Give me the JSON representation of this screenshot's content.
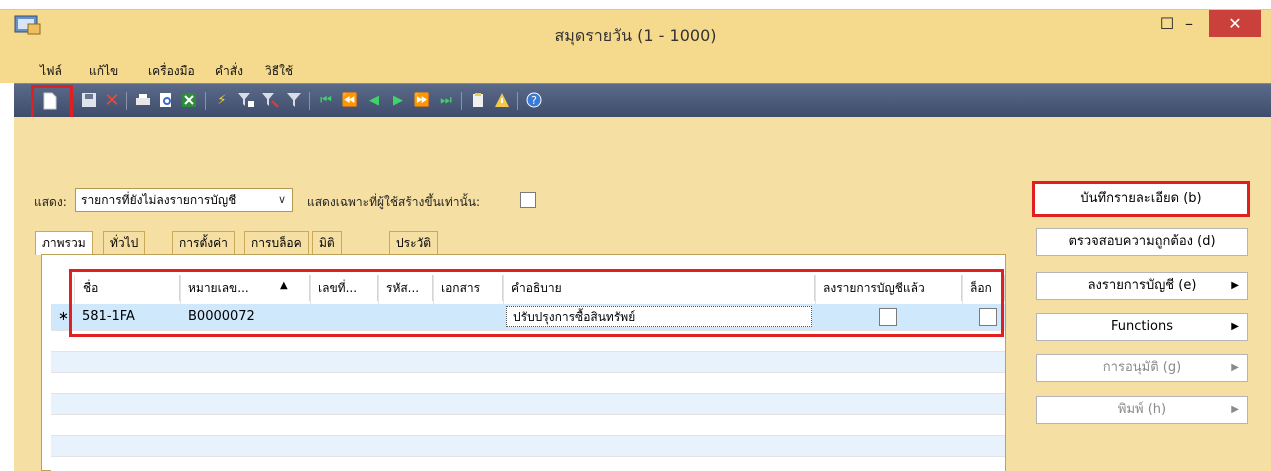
{
  "window": {
    "title": "สมุดรายวัน (1 - 1000)",
    "minimize": "–",
    "maximize": "☐",
    "close": "✕"
  },
  "menu": [
    "ไฟล์",
    "แก้ไข",
    "เครื่องมือ",
    "คำสั่ง",
    "วิธีใช้"
  ],
  "filter": {
    "show_label": "แสดง:",
    "show_value": "รายการที่ยังไม่ลงรายการบัญชี",
    "only_mine_label": "แสดงเฉพาะที่ผู้ใช้สร้างขึ้นเท่านั้น:"
  },
  "tabs": [
    "ภาพรวม",
    "ทั่วไป",
    "การตั้งค่า",
    "การบล็อค",
    "มิติ",
    "ประวัติ"
  ],
  "grid": {
    "columns": [
      "ชื่อ",
      "หมายเลข...",
      "เลขที่...",
      "รหัส...",
      "เอกสาร",
      "คำอธิบาย",
      "ลงรายการบัญชีแล้ว",
      "ล็อก"
    ],
    "sort_icon": "▲",
    "row_marker": "∗",
    "rows": [
      {
        "name": "581-1FA",
        "number": "B0000072",
        "voucher": "",
        "code": "",
        "document": "",
        "description": "ปรับปรุงการซื้อสินทรัพย์",
        "posted": false,
        "locked": false
      }
    ]
  },
  "buttons": {
    "record": "บันทึกรายละเอียด (b)",
    "validate": "ตรวจสอบความถูกต้อง (d)",
    "post": "ลงรายการบัญชี (e)",
    "functions": "Functions",
    "approve": "การอนุมัติ (g)",
    "print": "พิมพ์ (h)",
    "arrow": "▶"
  },
  "colors": {
    "titlebar": "#f5d98c",
    "toolbar": "#4a5878",
    "highlight": "#e02020",
    "selected_row": "#cfe8fb"
  }
}
